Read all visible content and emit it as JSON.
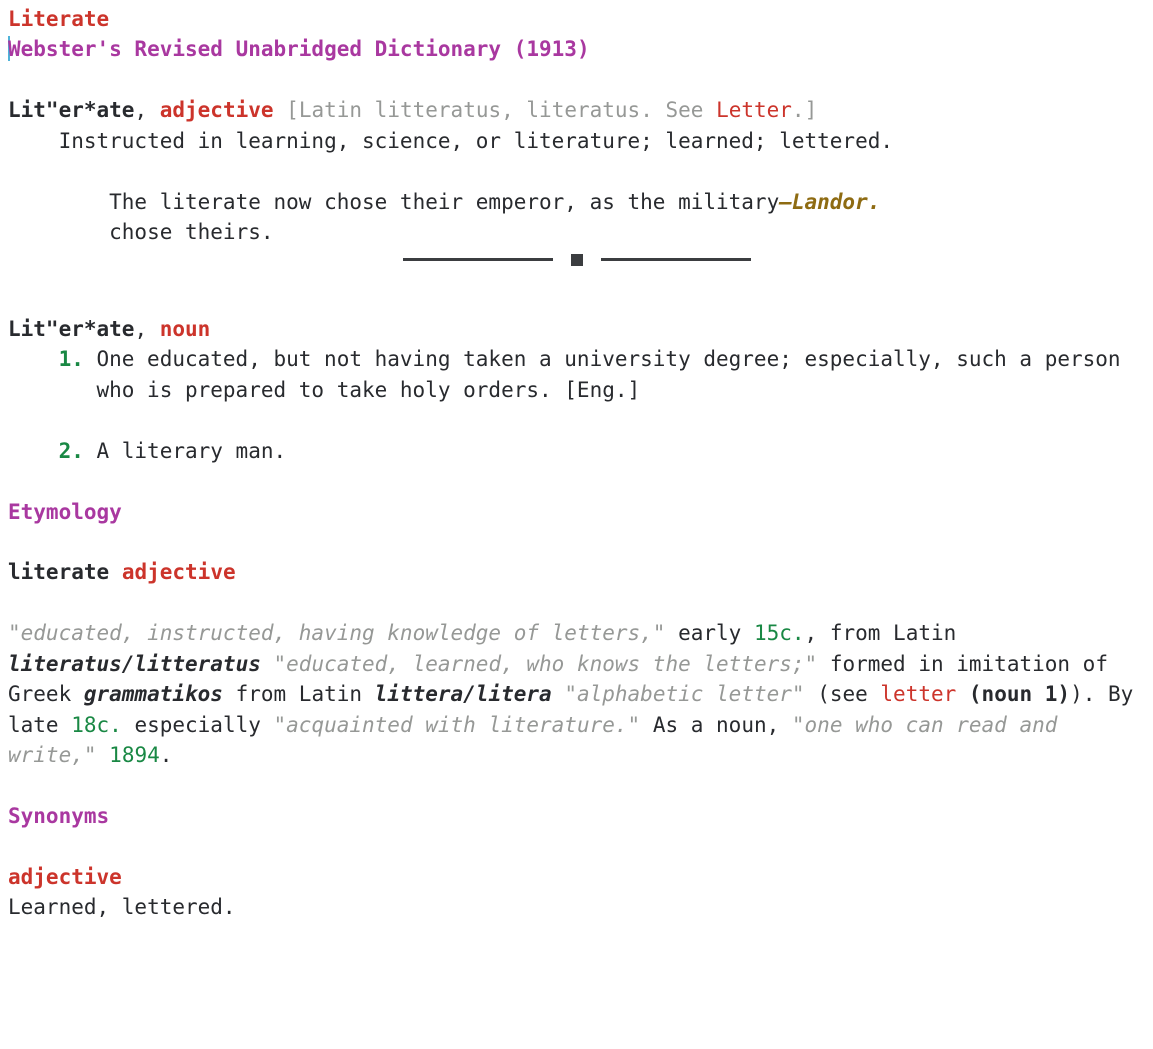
{
  "header": {
    "title": "Literate",
    "source": "Webster's Revised Unabridged Dictionary (1913)"
  },
  "entry1": {
    "headword": "Lit\"er*ate",
    "sep": ", ",
    "pos": "adjective",
    "brackets": {
      "open": " [",
      "text": "Latin litteratus, literatus. See ",
      "link": "Letter",
      "close": ".]"
    },
    "definition": "Instructed in learning, science, or literature; learned; lettered.",
    "quote": {
      "text": "The literate now chose their emperor, as the military chose theirs.",
      "attribution": "—Landor."
    }
  },
  "entry2": {
    "headword": "Lit\"er*ate",
    "sep": ", ",
    "pos": "noun",
    "senses": [
      "One educated, but not having taken a university degree; especially, such a person who is prepared to take holy orders. [Eng.]",
      "A literary man."
    ]
  },
  "etymology": {
    "heading": "Etymology",
    "headword": "literate",
    "pos": "adjective",
    "p": {
      "g1": "\"educated, instructed, having knowledge of letters,\"",
      "t1": " early ",
      "y1": "15c.",
      "t2": ", from Latin ",
      "term1": "literatus/litteratus",
      "g2": " \"educated, learned, who knows the letters;\"",
      "t3": " formed in imitation of Greek ",
      "term2": "grammatikos",
      "t4": " from Latin ",
      "term3": "littera/litera",
      "g3": " \"alphabetic letter\"",
      "t5": " (see ",
      "link": "letter",
      "t6": " (noun 1)",
      "t7": "). By late ",
      "y2": "18c.",
      "t8": " especially ",
      "g4": "\"acquainted with literature.\"",
      "t9": " As a noun, ",
      "g5": "\"one who can read and write,\"",
      "t10": " ",
      "y3": "1894",
      "t11": "."
    }
  },
  "synonyms": {
    "heading": "Synonyms",
    "pos": "adjective",
    "list": "Learned, lettered."
  }
}
